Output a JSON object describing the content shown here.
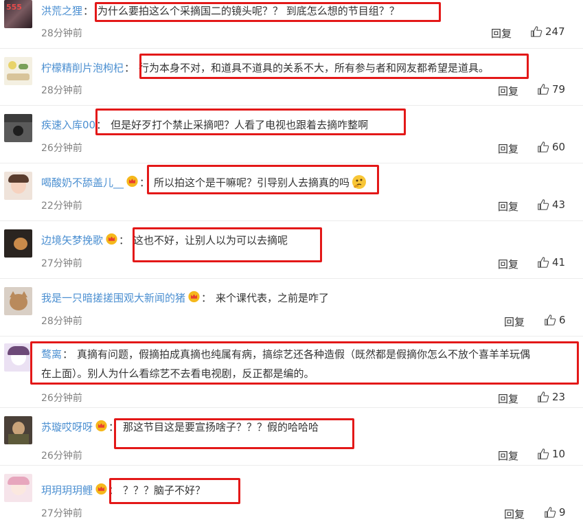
{
  "reply_label": "回复",
  "comments": [
    {
      "user": "洪荒之狸",
      "vip": false,
      "text": "为什么要拍这么个采摘国二的镜头呢？？ 到底怎么想的节目组？？",
      "time": "28分钟前",
      "likes": "247"
    },
    {
      "user": "柠檬精削片泡枸杞",
      "vip": false,
      "text": "行为本身不对，和道具不道具的关系不大，所有参与者和网友都希望是道具。",
      "time": "28分钟前",
      "likes": "79"
    },
    {
      "user": "疾速入库00",
      "vip": false,
      "text": "但是好歹打个禁止采摘吧？人看了电视也跟着去摘咋整啊",
      "time": "26分钟前",
      "likes": "60"
    },
    {
      "user": "喝酸奶不舔盖儿__",
      "vip": true,
      "text": "所以拍这个是干嘛呢？引导别人去摘真的吗",
      "time": "22分钟前",
      "likes": "43"
    },
    {
      "user": "边境矢梦挽歌",
      "vip": true,
      "text": "这也不好，让别人以为可以去摘呢",
      "time": "27分钟前",
      "likes": "41"
    },
    {
      "user": "我是一只暗搓搓围观大新闻的猪",
      "vip": true,
      "text": "来个课代表，之前是咋了",
      "time": "28分钟前",
      "likes": "6"
    },
    {
      "user": "鹜离",
      "vip": false,
      "text": "真摘有问题，假摘拍成真摘也纯属有病，搞综艺还各种造假（既然都是假摘你怎么不放个喜羊羊玩偶",
      "text2": "在上面）。别人为什么看综艺不去看电视剧，反正都是编的。",
      "time": "26分钟前",
      "likes": "23"
    },
    {
      "user": "苏璇哎呀呀",
      "vip": true,
      "text": "那这节目这是要宣扬啥子？？？假的哈哈哈",
      "time": "26分钟前",
      "likes": "10"
    },
    {
      "user": "玥玥玥玥鲤",
      "vip": true,
      "text": "？？？脑子不好？",
      "time": "27分钟前",
      "likes": "9"
    }
  ],
  "colors": {
    "username": "#4b8fd1",
    "highlight_box": "#e31818",
    "text": "#333333",
    "meta": "#808080"
  }
}
